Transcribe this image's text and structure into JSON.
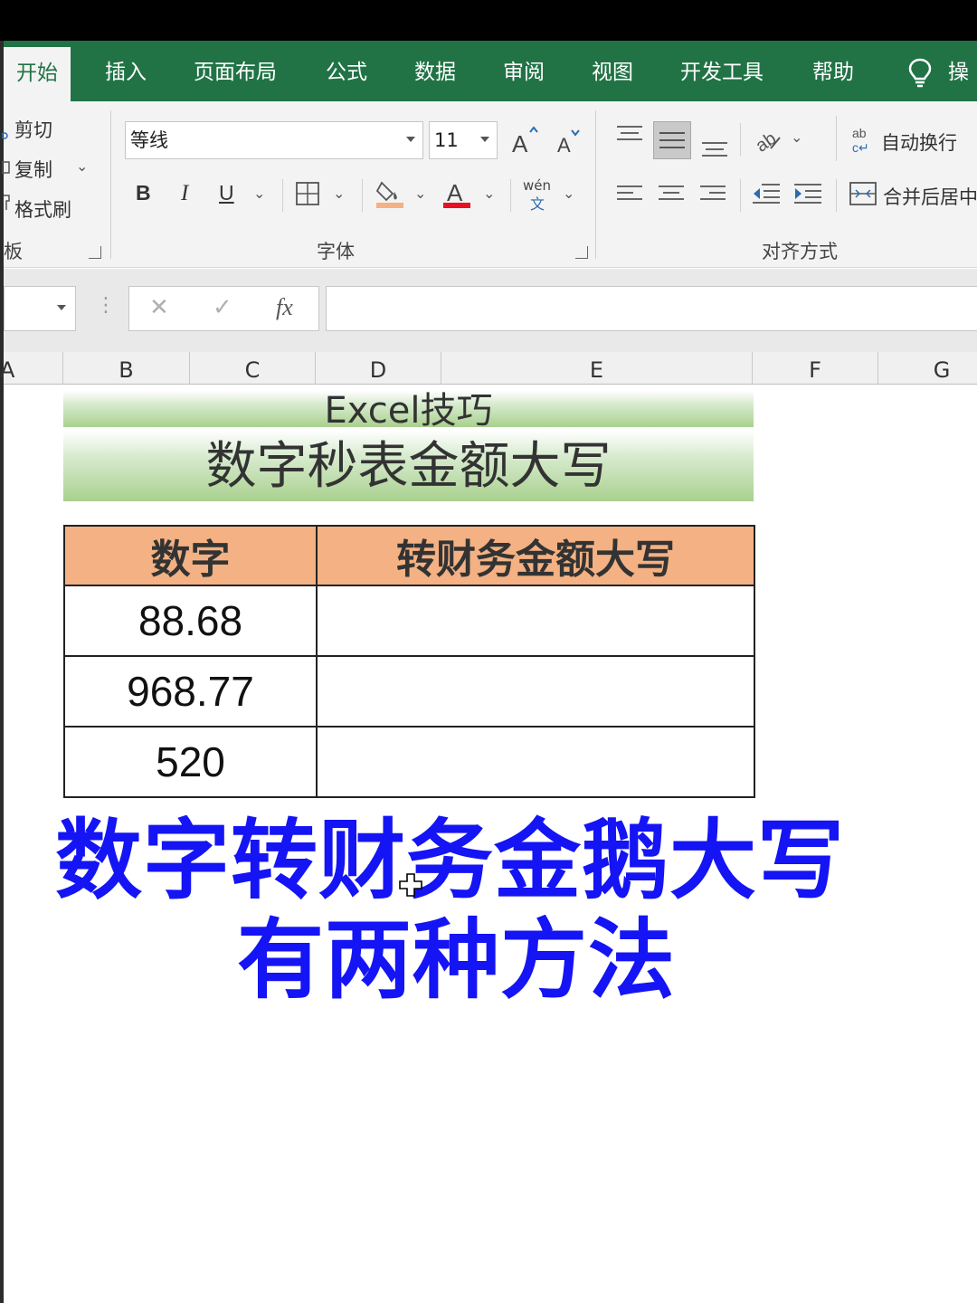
{
  "ribbon_tabs": [
    {
      "label": "开始",
      "active": true
    },
    {
      "label": "插入"
    },
    {
      "label": "页面布局"
    },
    {
      "label": "公式"
    },
    {
      "label": "数据"
    },
    {
      "label": "审阅"
    },
    {
      "label": "视图"
    },
    {
      "label": "开发工具"
    },
    {
      "label": "帮助"
    },
    {
      "label": "操"
    }
  ],
  "clipboard": {
    "cut": "剪切",
    "copy": "复制",
    "format_painter": "格式刷",
    "group_label": "板"
  },
  "font": {
    "name": "等线",
    "size": "11",
    "bold": "B",
    "italic": "I",
    "underline": "U",
    "phonetic_top": "wén",
    "phonetic_bottom": "文",
    "group_label": "字体"
  },
  "alignment": {
    "wrap_text": "自动换行",
    "merge_center": "合并后居中",
    "group_label": "对齐方式"
  },
  "formula_bar": {
    "cancel": "✕",
    "enter": "✓",
    "fx": "fx",
    "value": ""
  },
  "columns": [
    "A",
    "B",
    "C",
    "D",
    "E",
    "F",
    "G"
  ],
  "sheet": {
    "title1": "Excel技巧",
    "title2": "数字秒表金额大写",
    "table": {
      "headers": [
        "数字",
        "转财务金额大写"
      ],
      "rows": [
        [
          "88.68",
          ""
        ],
        [
          "968.77",
          ""
        ],
        [
          "520",
          ""
        ]
      ]
    }
  },
  "overlay": {
    "line1": "数字转财务金鹅大写",
    "line2": "有两种方法"
  },
  "colors": {
    "ribbon_green": "#217346",
    "header_fill": "#f4b183",
    "banner_green": "#a9d08e",
    "overlay_blue": "#1414f5",
    "font_color_red": "#e81123",
    "fill_color": "#f4b183"
  }
}
